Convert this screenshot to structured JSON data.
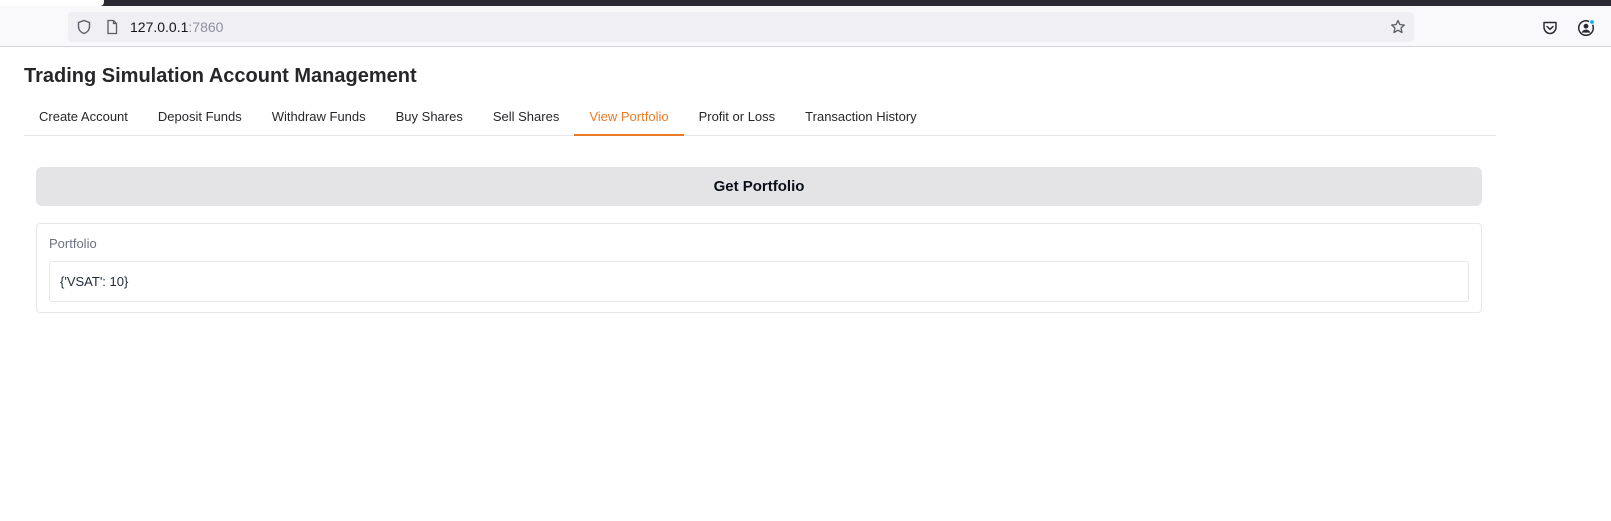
{
  "browser": {
    "url_host": "127.0.0.1",
    "url_port": ":7860"
  },
  "app": {
    "title": "Trading Simulation Account Management",
    "accent_color": "#ea7b27"
  },
  "tabs": [
    {
      "label": "Create Account"
    },
    {
      "label": "Deposit Funds"
    },
    {
      "label": "Withdraw Funds"
    },
    {
      "label": "Buy Shares"
    },
    {
      "label": "Sell Shares"
    },
    {
      "label": "View Portfolio",
      "active": true
    },
    {
      "label": "Profit or Loss"
    },
    {
      "label": "Transaction History"
    }
  ],
  "portfolio": {
    "button_label": "Get Portfolio",
    "output_label": "Portfolio",
    "output_value": "{'VSAT': 10}"
  }
}
